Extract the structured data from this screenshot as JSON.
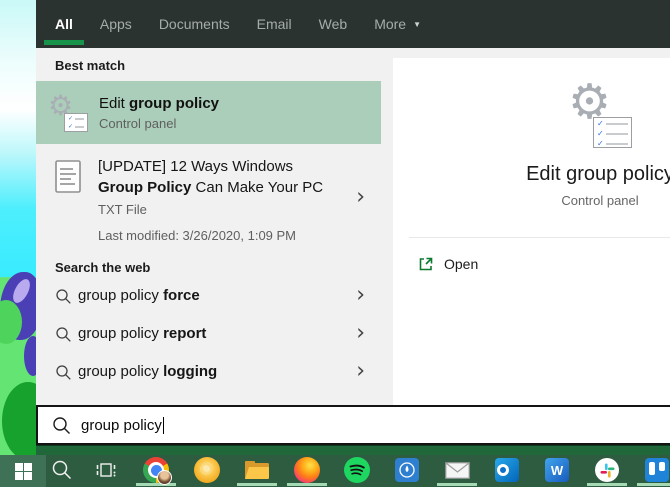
{
  "tabs": {
    "items": [
      {
        "label": "All",
        "active": true
      },
      {
        "label": "Apps",
        "active": false
      },
      {
        "label": "Documents",
        "active": false
      },
      {
        "label": "Email",
        "active": false
      },
      {
        "label": "Web",
        "active": false
      },
      {
        "label": "More",
        "active": false,
        "has_dropdown": true
      }
    ]
  },
  "best_match": {
    "header": "Best match",
    "title_regular": "Edit ",
    "title_bold": "group policy",
    "subtitle": "Control panel"
  },
  "document_result": {
    "line1": "[UPDATE] 12 Ways Windows",
    "line2_bold": "Group Policy",
    "line2_regular": " Can Make Your PC",
    "file_type": "TXT File",
    "last_modified": "Last modified: 3/26/2020, 1:09 PM"
  },
  "web_search": {
    "header": "Search the web",
    "items": [
      {
        "prefix": "group policy ",
        "bold": "force"
      },
      {
        "prefix": "group policy ",
        "bold": "report"
      },
      {
        "prefix": "group policy ",
        "bold": "logging"
      }
    ]
  },
  "preview": {
    "title": "Edit group policy",
    "subtitle": "Control panel",
    "open_label": "Open"
  },
  "search_input": {
    "value": "group policy"
  },
  "taskbar": {
    "icons": [
      "windows-start",
      "taskbar-search",
      "task-view",
      "chrome",
      "chrome-canary",
      "file-explorer",
      "firefox",
      "spotify",
      "blue-emblem-app",
      "mail",
      "outlook",
      "word",
      "slack",
      "trello"
    ],
    "running": [
      "chrome",
      "file-explorer",
      "firefox",
      "mail",
      "slack",
      "trello"
    ]
  },
  "glyphs": {
    "dropdown_arrow": "▼",
    "chevron_right": "›",
    "gear": "⚙",
    "check": "✓",
    "word_letter": "W"
  },
  "colors": {
    "tab_bar_bg": "#2a332f",
    "accent_green": "#18944a",
    "best_match_highlight": "#abceba",
    "list_bg": "#f1f1f1",
    "taskbar_bg": "#2e5c41",
    "window_bottom_strip": "#20673a",
    "open_icon_green": "#0b7a2f"
  }
}
